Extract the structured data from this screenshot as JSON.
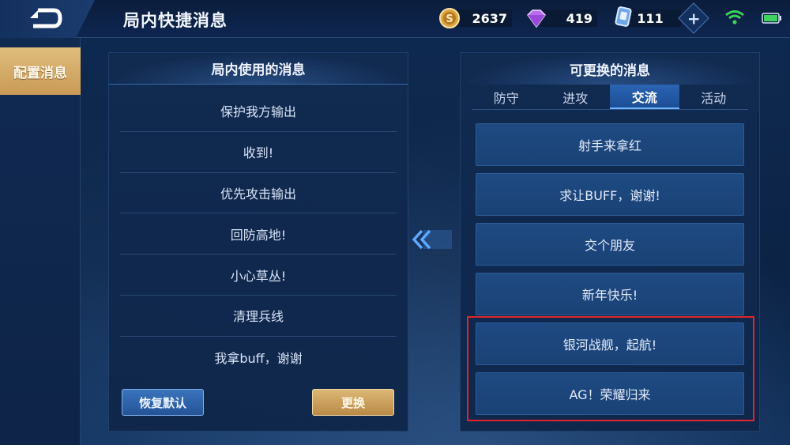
{
  "header": {
    "title": "局内快捷消息",
    "resources": {
      "gold": "2637",
      "diamonds": "419",
      "vouchers": "111"
    },
    "plus_label": "+"
  },
  "sidebar": {
    "active_tab": "配置消息"
  },
  "left_panel": {
    "title": "局内使用的消息",
    "messages": [
      "保护我方输出",
      "收到!",
      "优先攻击输出",
      "回防高地!",
      "小心草丛!",
      "清理兵线",
      "我拿buff，谢谢"
    ],
    "reset_button": "恢复默认",
    "replace_button": "更换"
  },
  "right_panel": {
    "title": "可更换的消息",
    "tabs": [
      "防守",
      "进攻",
      "交流",
      "活动"
    ],
    "active_tab_index": 2,
    "options": [
      "射手来拿红",
      "求让BUFF，谢谢!",
      "交个朋友",
      "新年快乐!",
      "银河战舰，起航!",
      "AG！荣耀归来"
    ]
  },
  "colors": {
    "background": "#0d2547",
    "accent_gold": "#c99a56",
    "accent_blue": "#2a64b3",
    "highlight_red": "#e0262a"
  }
}
